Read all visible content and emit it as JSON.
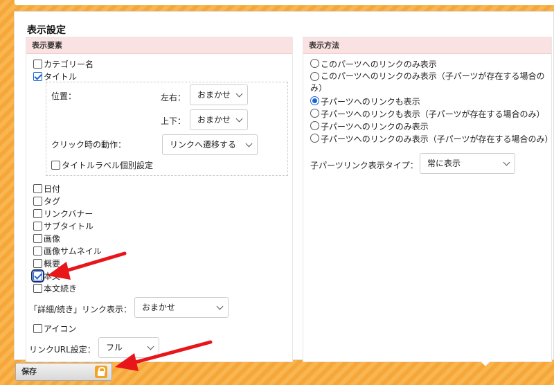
{
  "section_title": "表示設定",
  "left_column": {
    "header": "表示要素",
    "items": [
      {
        "label": "カテゴリー名",
        "checked": false
      },
      {
        "label": "タイトル",
        "checked": true
      },
      {
        "label": "日付",
        "checked": false
      },
      {
        "label": "タグ",
        "checked": false
      },
      {
        "label": "リンクバナー",
        "checked": false
      },
      {
        "label": "サブタイトル",
        "checked": false
      },
      {
        "label": "画像",
        "checked": false
      },
      {
        "label": "画像サムネイル",
        "checked": false
      },
      {
        "label": "概要",
        "checked": false
      },
      {
        "label": "本文",
        "checked": true
      },
      {
        "label": "本文続き",
        "checked": false
      }
    ],
    "title_settings": {
      "position_label": "位置：",
      "horizontal_label": "左右：",
      "horizontal_value": "おまかせ",
      "vertical_label": "上下：",
      "vertical_value": "おまかせ",
      "click_label": "クリック時の動作：",
      "click_value": "リンクへ遷移する",
      "label_individual": "タイトルラベル個別設定"
    },
    "detail_link_label": "「詳細/続き」リンク表示：",
    "detail_link_value": "おまかせ",
    "icon_label": "アイコン",
    "link_url_label": "リンクURL設定：",
    "link_url_value": "フル"
  },
  "right_column": {
    "header": "表示方法",
    "options": [
      {
        "label": "このパーツへのリンクのみ表示",
        "selected": false
      },
      {
        "label": "このパーツへのリンクのみ表示（子パーツが存在する場合のみ）",
        "selected": false
      },
      {
        "label": "子パーツへのリンクも表示",
        "selected": true
      },
      {
        "label": "子パーツへのリンクも表示（子パーツが存在する場合のみ）",
        "selected": false
      },
      {
        "label": "子パーツへのリンクのみ表示",
        "selected": false
      },
      {
        "label": "子パーツへのリンクのみ表示（子パーツが存在する場合のみ）",
        "selected": false
      }
    ],
    "child_link_type_label": "子パーツリンク表示タイプ：",
    "child_link_type_value": "常に表示"
  },
  "footer": {
    "save_label": "保存"
  },
  "colors": {
    "accent": "#1a63d8",
    "header_bg": "#fbe2e2",
    "footer_orange": "#f6a73a",
    "arrow_red": "#e8161b"
  }
}
